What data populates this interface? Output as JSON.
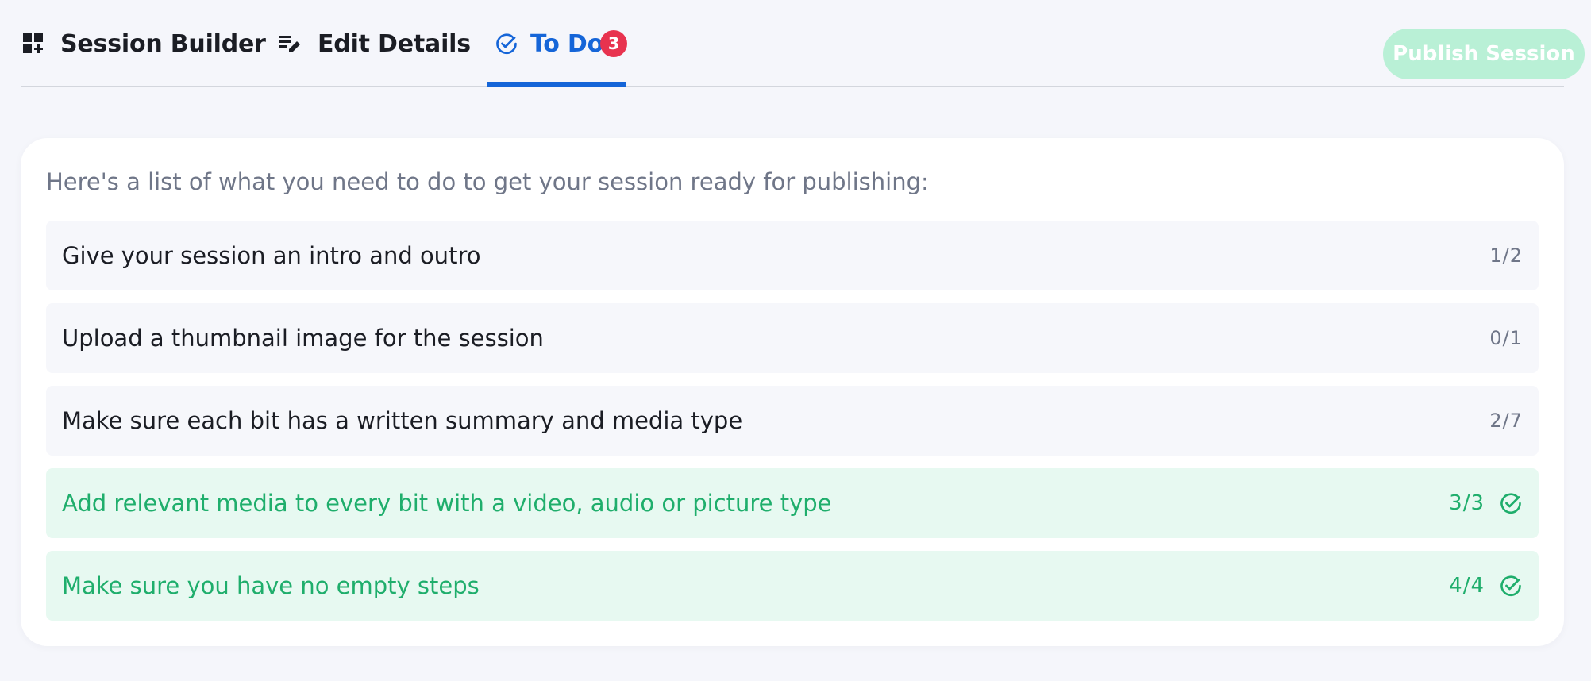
{
  "tabs": {
    "builder": {
      "label": "Session Builder",
      "icon": "dashboard-add-icon"
    },
    "details": {
      "label": "Edit Details",
      "icon": "edit-list-icon"
    },
    "todo": {
      "label": "To Do",
      "icon": "check-circle-icon",
      "badge": "3",
      "active": true
    }
  },
  "header": {
    "publish_label": "Publish Session"
  },
  "todo": {
    "intro": "Here's a list of what you need to do to get your session ready for publishing:",
    "items": [
      {
        "label": "Give your session an intro and outro",
        "count": "1/2",
        "complete": false
      },
      {
        "label": "Upload a thumbnail image for the session",
        "count": "0/1",
        "complete": false
      },
      {
        "label": "Make sure each bit has a written summary and media type",
        "count": "2/7",
        "complete": false
      },
      {
        "label": "Add relevant media to every bit with a video, audio or picture type",
        "count": "3/3",
        "complete": true
      },
      {
        "label": "Make sure you have no empty steps",
        "count": "4/4",
        "complete": true
      }
    ]
  },
  "colors": {
    "accent": "#1565d8",
    "badge": "#e8334f",
    "success": "#1fae6c",
    "success_bg": "#e7f9f1",
    "publish_disabled": "#b9f0d6"
  }
}
